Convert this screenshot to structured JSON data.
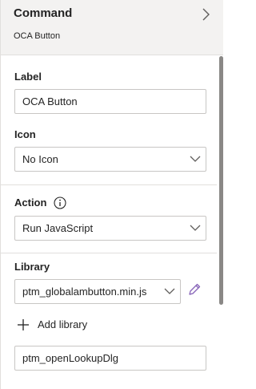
{
  "header": {
    "title": "Command",
    "subtitle": "OCA Button",
    "chevron_icon": "chevron-right-icon"
  },
  "fields": {
    "label": {
      "label": "Label",
      "value": "OCA Button"
    },
    "icon": {
      "label": "Icon",
      "selected": "No Icon"
    },
    "action": {
      "label": "Action",
      "info_icon": "info-icon",
      "selected": "Run JavaScript"
    },
    "library": {
      "label": "Library",
      "selected": "ptm_globalambutton.min.js",
      "edit_icon": "pencil-icon",
      "add_label": "Add library",
      "add_icon": "plus-icon",
      "function_value": "ptm_openLookupDlg"
    }
  },
  "colors": {
    "header_bg": "#f3f2f1",
    "border": "#c8c6c4",
    "accent_purple": "#8764b8",
    "scrollbar": "#8a8886",
    "text": "#242424"
  }
}
